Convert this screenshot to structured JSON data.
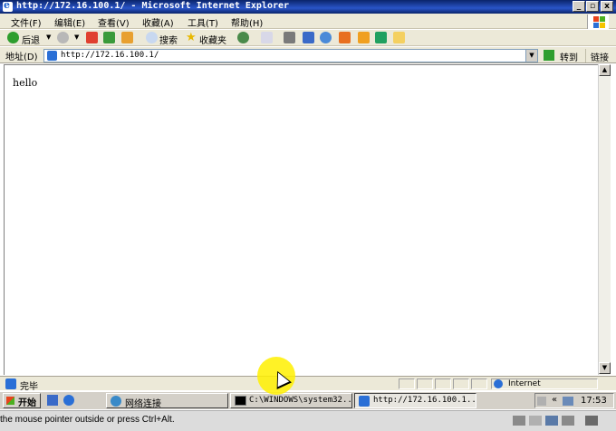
{
  "window": {
    "title": "http://172.16.100.1/ - Microsoft Internet Explorer",
    "controls": {
      "minimize": "_",
      "restore": "▫",
      "close": "x"
    }
  },
  "menu": {
    "items": [
      "文件(F)",
      "编辑(E)",
      "查看(V)",
      "收藏(A)",
      "工具(T)",
      "帮助(H)"
    ]
  },
  "toolbar": {
    "back_label": "后退",
    "search_label": "搜索",
    "favorites_label": "收藏夹"
  },
  "address": {
    "label": "地址(D)",
    "url": "http://172.16.100.1/",
    "go_label": "转到",
    "links_label": "链接"
  },
  "page": {
    "body_text": "hello"
  },
  "status": {
    "text": "完毕",
    "zone": "Internet"
  },
  "taskbar": {
    "start_label": "开始",
    "tasks": [
      {
        "label": "网络连接"
      },
      {
        "label": "C:\\WINDOWS\\system32..."
      },
      {
        "label": "http://172.16.100.1..."
      }
    ],
    "clock": "17:53"
  },
  "hint": {
    "text": "the mouse pointer outside or press Ctrl+Alt."
  },
  "colors": {
    "titlebar": "#0a246a",
    "chrome": "#ece9d8",
    "taskbar": "#d4d0c8",
    "cursor_highlight": "#fff000"
  }
}
